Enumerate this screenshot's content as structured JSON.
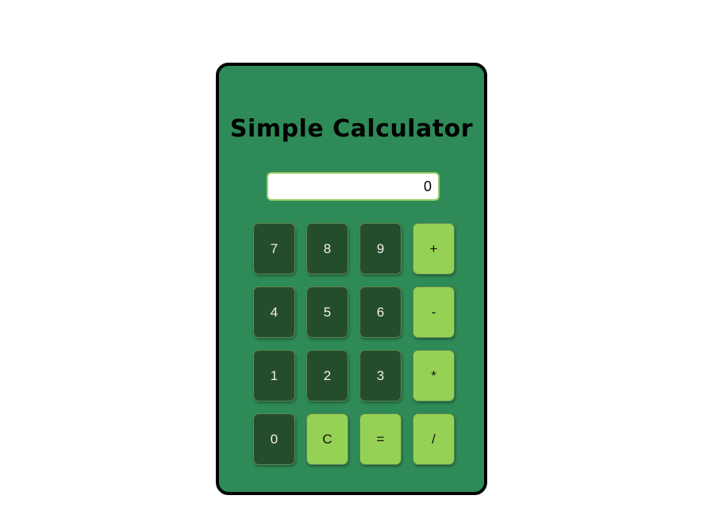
{
  "calculator": {
    "title": "Simple Calculator",
    "display_value": "0",
    "keys": {
      "k7": "7",
      "k8": "8",
      "k9": "9",
      "plus": "+",
      "k4": "4",
      "k5": "5",
      "k6": "6",
      "minus": "-",
      "k1": "1",
      "k2": "2",
      "k3": "3",
      "multiply": "*",
      "k0": "0",
      "clear": "C",
      "equals": "=",
      "divide": "/"
    }
  },
  "colors": {
    "page_background": "#ffffff",
    "calculator_body": "#2e8b57",
    "number_key": "#264d2b",
    "operator_key": "#95d155",
    "border": "#000000"
  }
}
